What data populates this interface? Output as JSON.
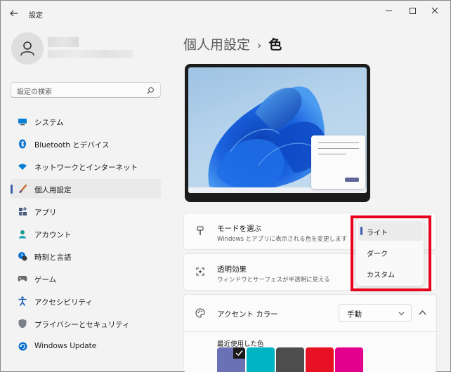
{
  "window": {
    "title": "設定"
  },
  "search": {
    "placeholder": "設定の検索"
  },
  "nav": {
    "items": [
      {
        "label": "システム",
        "icon": "monitor-icon"
      },
      {
        "label": "Bluetooth とデバイス",
        "icon": "bluetooth-icon"
      },
      {
        "label": "ネットワークとインターネット",
        "icon": "wifi-icon"
      },
      {
        "label": "個人用設定",
        "icon": "paint-brush-icon",
        "selected": true
      },
      {
        "label": "アプリ",
        "icon": "apps-icon"
      },
      {
        "label": "アカウント",
        "icon": "person-icon"
      },
      {
        "label": "時刻と言語",
        "icon": "clock-globe-icon"
      },
      {
        "label": "ゲーム",
        "icon": "gamepad-icon"
      },
      {
        "label": "アクセシビリティ",
        "icon": "accessibility-icon"
      },
      {
        "label": "プライバシーとセキュリティ",
        "icon": "shield-icon"
      },
      {
        "label": "Windows Update",
        "icon": "update-icon"
      }
    ]
  },
  "header": {
    "parent": "個人用設定",
    "separator": "›",
    "current": "色"
  },
  "settings": {
    "mode": {
      "title": "モードを選ぶ",
      "description": "Windows とアプリに表示される色を変更します"
    },
    "transparency": {
      "title": "透明効果",
      "description": "ウィンドウとサーフェスが半透明に見える"
    },
    "accent": {
      "title": "アクセント カラー",
      "dropdown_value": "手動",
      "recent_label": "最近使用した色",
      "recent_colors": [
        "#6b71b5",
        "#00b4c3",
        "#4d4d4d",
        "#e81123",
        "#e3008c"
      ]
    }
  },
  "mode_menu": {
    "options": [
      {
        "label": "ライト",
        "selected": true
      },
      {
        "label": "ダーク",
        "selected": false
      },
      {
        "label": "カスタム",
        "selected": false
      }
    ]
  },
  "colors": {
    "accent": "#3a5ea8",
    "highlight": "#e8001c"
  }
}
